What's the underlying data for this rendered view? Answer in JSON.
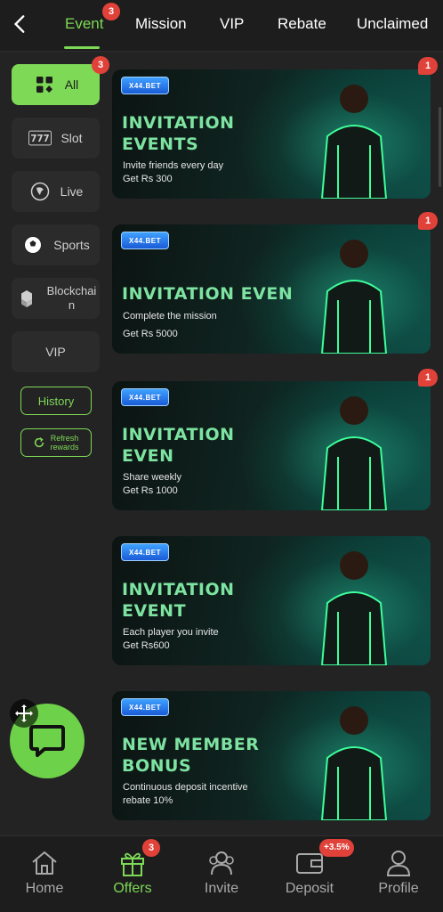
{
  "header": {
    "back_icon": "chevron-left-icon",
    "tabs": [
      {
        "label": "Event",
        "active": true,
        "badge": "3"
      },
      {
        "label": "Mission"
      },
      {
        "label": "VIP"
      },
      {
        "label": "Rebate"
      },
      {
        "label": "Unclaimed"
      }
    ]
  },
  "sidebar": {
    "items": [
      {
        "label": "All",
        "icon": "grid-icon",
        "active": true,
        "badge": "3"
      },
      {
        "label": "Slot",
        "icon": "slot-777-icon"
      },
      {
        "label": "Live",
        "icon": "live-dealer-icon"
      },
      {
        "label": "Sports",
        "icon": "soccer-ball-icon"
      },
      {
        "label": "Blockchai\nn",
        "icon": "blockchain-icon"
      },
      {
        "label": "VIP"
      }
    ],
    "history_label": "History",
    "refresh_label_line1": "Refresh",
    "refresh_label_line2": "rewards"
  },
  "banners": [
    {
      "tag": "X44.BET",
      "title_line1": "INVITATION",
      "title_line2": "EVENTS",
      "sub1": "Invite friends every day",
      "sub2": "Get Rs 300",
      "badge": "1"
    },
    {
      "tag": "X44.BET",
      "title_line1": "INVITATION EVEN",
      "title_line2": "",
      "sub1": "Complete the mission",
      "sub2": "Get Rs 5000",
      "badge": "1"
    },
    {
      "tag": "X44.BET",
      "title_line1": "INVITATION",
      "title_line2": "EVEN",
      "sub1": "Share weekly",
      "sub2": "Get Rs 1000",
      "badge": "1"
    },
    {
      "tag": "X44.BET",
      "title_line1": "INVITATION",
      "title_line2": "EVENT",
      "sub1": "Each player you invite",
      "sub2": "Get Rs600",
      "badge": ""
    },
    {
      "tag": "X44.BET",
      "title_line1": "NEW MEMBER",
      "title_line2": "BONUS",
      "sub1": "Continuous deposit incentive",
      "sub2": "rebate 10%",
      "badge": ""
    }
  ],
  "bottom_nav": [
    {
      "label": "Home",
      "icon": "home-icon"
    },
    {
      "label": "Offers",
      "icon": "gift-icon",
      "active": true,
      "badge": "3"
    },
    {
      "label": "Invite",
      "icon": "users-icon"
    },
    {
      "label": "Deposit",
      "icon": "wallet-icon",
      "badge": "+3.5%"
    },
    {
      "label": "Profile",
      "icon": "profile-icon"
    }
  ],
  "colors": {
    "accent": "#7ed957",
    "badge": "#e0423a",
    "background": "#232323"
  }
}
